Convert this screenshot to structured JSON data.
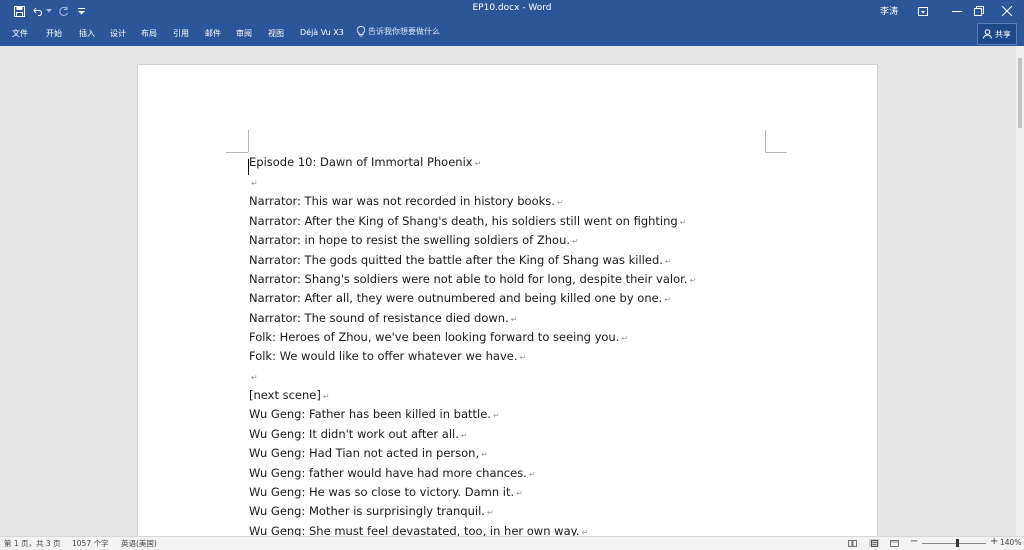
{
  "titlebar": {
    "title": "EP10.docx - Word",
    "user": "李涛"
  },
  "ribbon": {
    "tabs": [
      "文件",
      "开始",
      "插入",
      "设计",
      "布局",
      "引用",
      "邮件",
      "审阅",
      "视图",
      "Déjà Vu X3"
    ],
    "tell_me": "告诉我你想要做什么",
    "share": "共享"
  },
  "document": {
    "lines": [
      "Episode 10: Dawn of Immortal Phoenix",
      "",
      "Narrator: This war was not recorded in history books.",
      "Narrator: After the King of Shang's death, his soldiers still went on fighting",
      "Narrator: in hope to resist the swelling soldiers of Zhou.",
      "Narrator: The gods quitted the battle after the King of Shang was killed.",
      "Narrator: Shang's soldiers were not able to hold for long, despite their valor.",
      "Narrator: After all, they were outnumbered and being killed one by one.",
      "Narrator: The sound of resistance died down.",
      "Folk: Heroes of Zhou, we've been looking forward to seeing you.",
      "Folk: We would like to offer whatever we have.",
      "",
      "[next scene]",
      "Wu Geng: Father has been killed in battle.",
      "Wu Geng: It didn't work out after all.",
      "Wu Geng: Had Tian not acted in person,",
      "Wu Geng: father would have had more chances.",
      "Wu Geng: He was so close to victory. Damn it.",
      "Wu Geng: Mother is surprisingly tranquil.",
      "Wu Geng: She must feel devastated, too, in her own way."
    ],
    "paragraph_mark": "↵"
  },
  "status": {
    "page": "第 1 页，共 3 页",
    "words": "1057 个字",
    "language": "英语(美国)",
    "zoom": "140%",
    "zoom_level_percent": 140
  },
  "colors": {
    "ribbon": "#2b579a",
    "canvas": "#e6e6e6",
    "page": "#ffffff"
  }
}
